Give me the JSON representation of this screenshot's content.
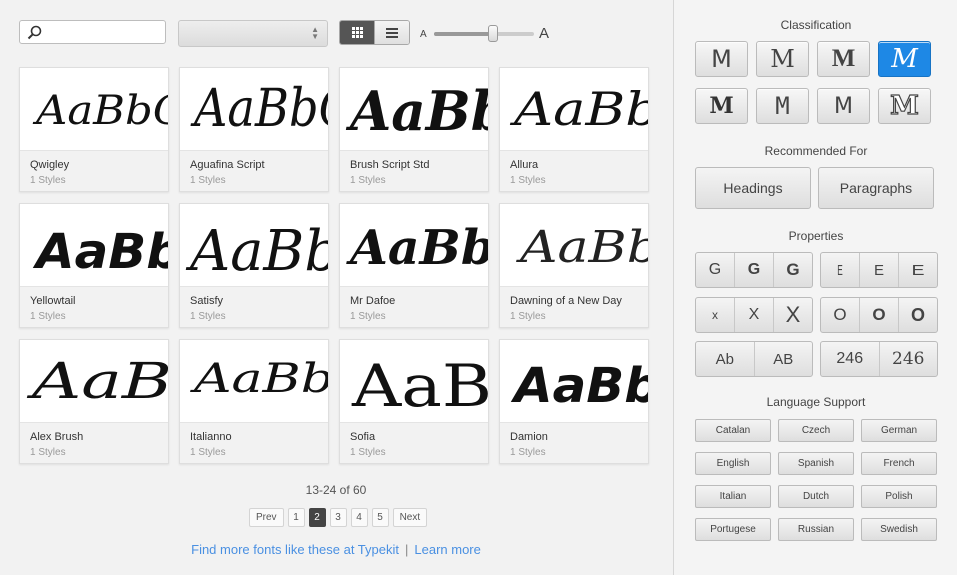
{
  "search": {
    "value": "",
    "placeholder": ""
  },
  "filter_select": {
    "value": ""
  },
  "size_slider": {
    "small_label": "A",
    "large_label": "A",
    "value": 0.6
  },
  "fonts": [
    {
      "name": "Qwigley",
      "styles": "1 Styles",
      "sample": "AaBbC"
    },
    {
      "name": "Aguafina Script",
      "styles": "1 Styles",
      "sample": "AaBbC"
    },
    {
      "name": "Brush Script Std",
      "styles": "1 Styles",
      "sample": "AaBb"
    },
    {
      "name": "Allura",
      "styles": "1 Styles",
      "sample": "AaBb"
    },
    {
      "name": "Yellowtail",
      "styles": "1 Styles",
      "sample": "AaBb"
    },
    {
      "name": "Satisfy",
      "styles": "1 Styles",
      "sample": "AaBb"
    },
    {
      "name": "Mr Dafoe",
      "styles": "1 Styles",
      "sample": "AaBb"
    },
    {
      "name": "Dawning of a New Day",
      "styles": "1 Styles",
      "sample": "AaBb"
    },
    {
      "name": "Alex Brush",
      "styles": "1 Styles",
      "sample": "AaB"
    },
    {
      "name": "Italianno",
      "styles": "1 Styles",
      "sample": "AaBb"
    },
    {
      "name": "Sofia",
      "styles": "1 Styles",
      "sample": "AaB"
    },
    {
      "name": "Damion",
      "styles": "1 Styles",
      "sample": "AaBb"
    }
  ],
  "pagination": {
    "range": "13-24 of 60",
    "prev": "Prev",
    "pages": [
      "1",
      "2",
      "3",
      "4",
      "5"
    ],
    "current": "2",
    "next": "Next"
  },
  "footer": {
    "find_more": "Find more fonts like these at Typekit",
    "separator": "|",
    "learn_more": "Learn more"
  },
  "sidebar": {
    "classification_title": "Classification",
    "classification_glyph": "M",
    "classification_selected": "script",
    "recommended_title": "Recommended For",
    "recommended": [
      "Headings",
      "Paragraphs"
    ],
    "properties_title": "Properties",
    "properties": [
      [
        "G",
        "G",
        "G"
      ],
      [
        "E",
        "E",
        "E"
      ],
      [
        "x",
        "X",
        "X"
      ],
      [
        "O",
        "O",
        "O"
      ],
      [
        "Ab",
        "AB"
      ],
      [
        "246",
        "246"
      ]
    ],
    "language_title": "Language Support",
    "languages": [
      "Catalan",
      "Czech",
      "German",
      "English",
      "Spanish",
      "French",
      "Italian",
      "Dutch",
      "Polish",
      "Portugese",
      "Russian",
      "Swedish"
    ]
  },
  "colors": {
    "accent": "#1e88e5",
    "link": "#4a90e2",
    "active_page": "#444444"
  }
}
